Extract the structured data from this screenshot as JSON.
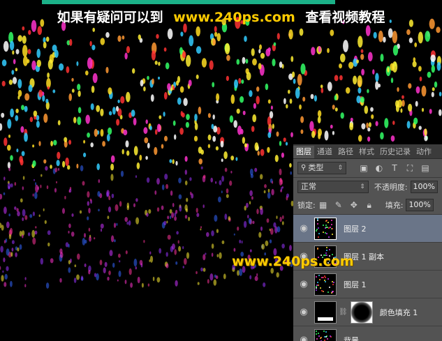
{
  "overlay": {
    "text_left": "如果有疑问可以到",
    "text_url": "www.240ps.com",
    "text_right": "查看视频教程"
  },
  "watermark": {
    "text": "www.240ps.com"
  },
  "panel": {
    "tabs": [
      "图层",
      "通道",
      "路径",
      "样式",
      "历史记录",
      "动作"
    ],
    "filter": {
      "label": "类型",
      "icons": [
        "image-filter-icon",
        "adjust-filter-icon",
        "text-filter-icon",
        "shape-filter-icon",
        "smart-filter-icon"
      ]
    },
    "blend_mode": "正常",
    "opacity": {
      "label": "不透明度:",
      "value": "100%"
    },
    "lock": {
      "label": "锁定:"
    },
    "fill": {
      "label": "填充:",
      "value": "100%"
    },
    "layers": [
      {
        "name": "图层 2",
        "selected": true,
        "type": "pixel"
      },
      {
        "name": "图层 1 副本",
        "selected": false,
        "type": "pixel"
      },
      {
        "name": "图层 1",
        "selected": false,
        "type": "pixel"
      },
      {
        "name": "颜色填充 1",
        "selected": false,
        "type": "fill"
      },
      {
        "name": "背景",
        "selected": false,
        "type": "pixel"
      }
    ]
  },
  "colors": {
    "panel_bg": "#535353",
    "selected_layer": "#6a7588",
    "url_yellow": "#ffcc00",
    "confetti": [
      "#ffee33",
      "#ff3333",
      "#33ff66",
      "#33ccff",
      "#ff33cc",
      "#ffffff",
      "#ff9933",
      "#9933ff",
      "#cc33ff"
    ]
  }
}
